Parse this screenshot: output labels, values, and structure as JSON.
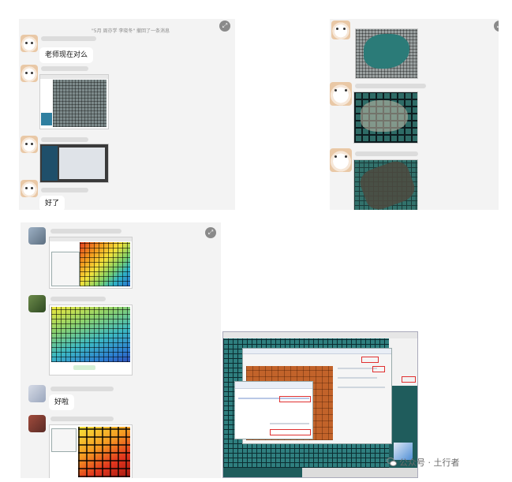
{
  "chat_top_left": {
    "system_notice": "\"5月 周亦学 李晓冬\" 撤回了一条消息",
    "message_1": "老师现在对么",
    "message_2": "好了"
  },
  "chat_bottom_left": {
    "message_1": "好啦"
  },
  "watermark": {
    "text": "公众号 · 土行者"
  },
  "icons": {
    "expand": "expand-icon",
    "wechat": "wechat-icon"
  },
  "colors": {
    "chat_background": "#f3f3f3",
    "bubble": "#ffffff",
    "teal_mesh": "#2f7f7f",
    "highlight_box": "#e03030"
  }
}
